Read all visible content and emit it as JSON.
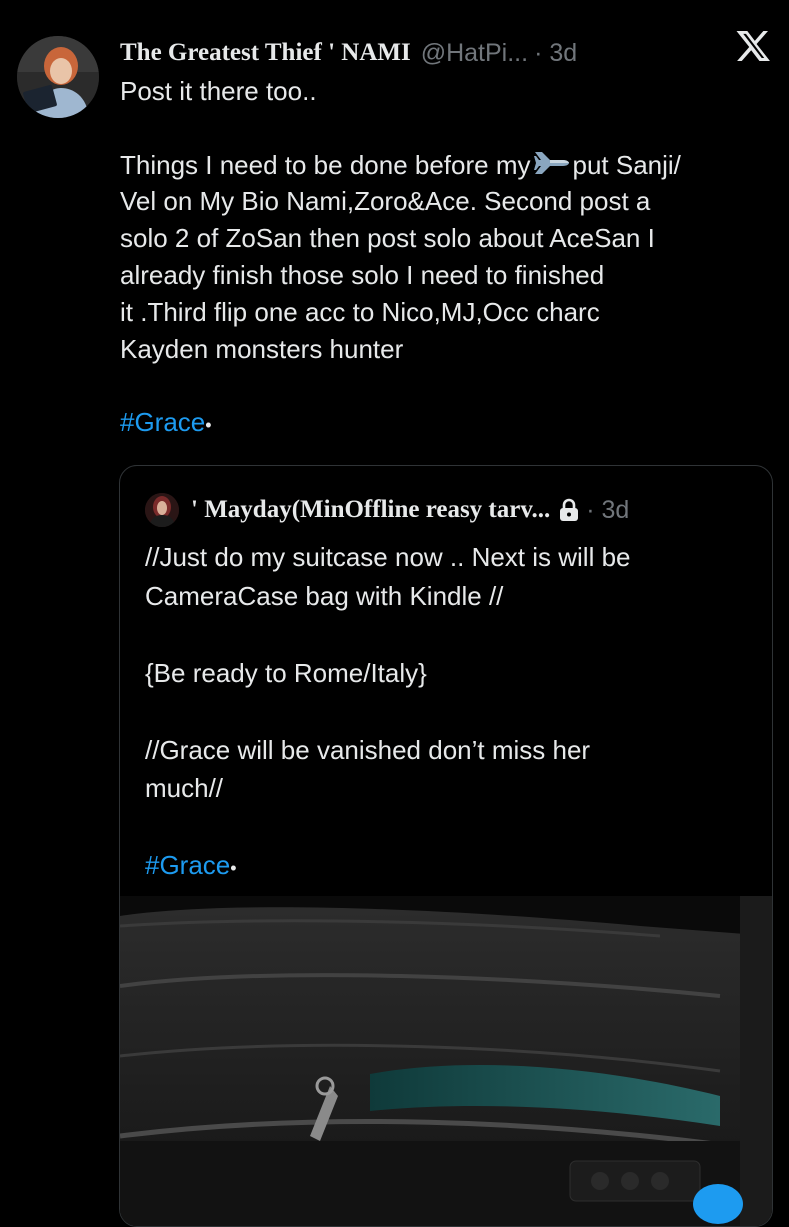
{
  "tweet": {
    "display_name": "The Greatest Thief ' NAMI",
    "handle": "@HatPi...",
    "time": "· 3d",
    "avatar_icon": "profile-avatar",
    "lines": [
      "Post it there too..",
      "",
      "Things I need to be done before my",
      "put Sanji/",
      "Vel on My Bio Nami,Zoro&Ace. Second post a",
      "solo 2 of ZoSan then post solo about AceSan I",
      "already finish those solo I need to finished",
      "it .Third flip one acc to Nico,MJ,Occ charc",
      "Kayden monsters hunter",
      ""
    ],
    "hashtag": "#Grace",
    "bullet": "•",
    "emoji": "airplane-icon",
    "brand_icon": "x-logo-icon"
  },
  "quote": {
    "display_name": "' Mayday(MinOffline reasy tarv...",
    "time": "· 3d",
    "lock_icon": "lock-icon",
    "lines": [
      "//Just do my suitcase now .. Next is will be",
      "CameraCase  bag with Kindle //",
      "",
      "{Be ready to Rome/Italy}",
      "",
      "//Grace will be vanished don’t miss her",
      "much//",
      ""
    ],
    "hashtag": "#Grace",
    "bullet": "•",
    "media": "suitcase-photo"
  },
  "colors": {
    "background": "#000000",
    "text": "#e7e9ea",
    "secondary": "#71767b",
    "link": "#1d9bf0",
    "border": "#2f3336"
  }
}
